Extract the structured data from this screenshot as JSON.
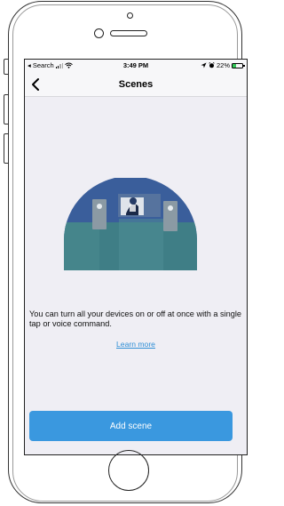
{
  "status_bar": {
    "back_app": "◂ Search",
    "time": "3:49 PM",
    "battery_percent": "22%",
    "battery_level": 0.22,
    "icons": [
      "signal-icon",
      "wifi-icon",
      "location-icon",
      "alarm-icon",
      "battery-charging-icon"
    ]
  },
  "nav": {
    "title": "Scenes",
    "back_icon": "chevron-left-icon"
  },
  "content": {
    "description": "You can turn all your devices on or off at once with a single tap or voice command.",
    "learn_more": "Learn more"
  },
  "actions": {
    "add_scene": "Add scene"
  },
  "colors": {
    "screen_background": "#efeef4",
    "primary_button": "#3a98df",
    "link": "#2f8fd6",
    "illustration_wall": "#3a5e9b",
    "illustration_floor": "#3f7e86"
  }
}
